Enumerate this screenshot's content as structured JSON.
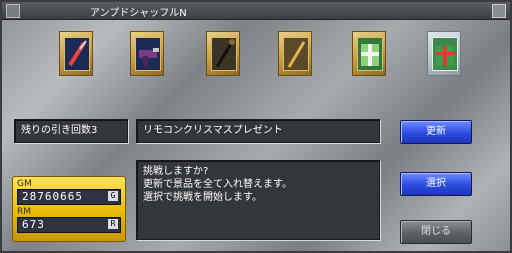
{
  "window": {
    "title": "アンプドシャッフルN"
  },
  "prizes": [
    {
      "icon": "spear-card-icon"
    },
    {
      "icon": "gun-card-icon"
    },
    {
      "icon": "staff-card-icon"
    },
    {
      "icon": "rod-card-icon"
    },
    {
      "icon": "green-gift-card-icon"
    },
    {
      "icon": "silver-gift-card-icon"
    }
  ],
  "info": {
    "remaining_draws": "残りの引き回数3",
    "item_name": "リモコンクリスマスプレゼント"
  },
  "message": {
    "lines": [
      "挑戦しますか?",
      "更新で景品を全て入れ替えます。",
      "選択で挑戦を開始します。"
    ]
  },
  "currency": {
    "gm_label": "GM",
    "gm_value": "28760665",
    "gm_unit": "G",
    "rm_label": "RM",
    "rm_value": "673",
    "rm_unit": "R"
  },
  "buttons": {
    "refresh": "更新",
    "select": "選択",
    "close": "閉じる"
  }
}
